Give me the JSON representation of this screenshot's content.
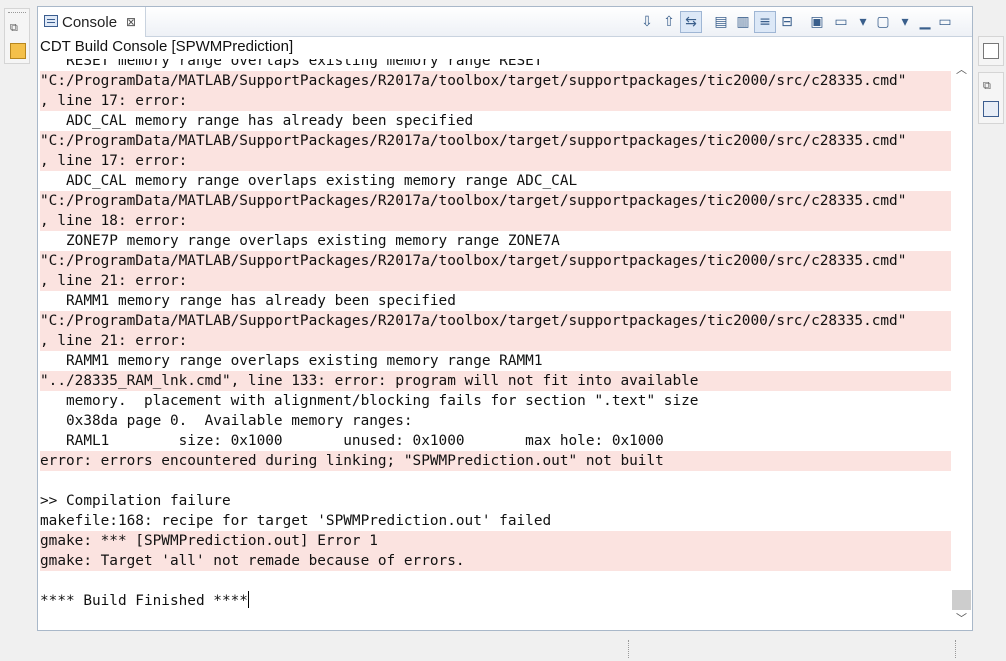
{
  "tab": {
    "title": "Console",
    "close_glyph": "⊠"
  },
  "console_title": "CDT Build Console [SPWMPrediction]",
  "toolbar": [
    {
      "name": "scroll-down-icon",
      "glyph": "⇩"
    },
    {
      "name": "scroll-up-icon",
      "glyph": "⇧"
    },
    {
      "name": "link-icon",
      "glyph": "⇆"
    },
    {
      "name": "copy-icon",
      "glyph": "▤"
    },
    {
      "name": "paste-icon",
      "glyph": "▥"
    },
    {
      "name": "word-wrap-icon",
      "glyph": "≡"
    },
    {
      "name": "clear-console-icon",
      "glyph": "⊟"
    },
    {
      "name": "pin-console-icon",
      "glyph": "▣"
    },
    {
      "name": "display-console-icon",
      "glyph": "▭"
    },
    {
      "name": "dropdown-icon",
      "glyph": "▾"
    },
    {
      "name": "open-console-icon",
      "glyph": "▢"
    },
    {
      "name": "dropdown-icon",
      "glyph": "▾"
    },
    {
      "name": "minimize-icon",
      "glyph": "▁"
    },
    {
      "name": "maximize-icon",
      "glyph": "▭"
    }
  ],
  "lines": [
    {
      "text": "   RESET memory range overlaps existing memory range RESET",
      "err": false
    },
    {
      "text": "\"C:/ProgramData/MATLAB/SupportPackages/R2017a/toolbox/target/supportpackages/tic2000/src/c28335.cmd\"",
      "err": true
    },
    {
      "text": ", line 17: error:",
      "err": true
    },
    {
      "text": "   ADC_CAL memory range has already been specified",
      "err": false
    },
    {
      "text": "\"C:/ProgramData/MATLAB/SupportPackages/R2017a/toolbox/target/supportpackages/tic2000/src/c28335.cmd\"",
      "err": true
    },
    {
      "text": ", line 17: error:",
      "err": true
    },
    {
      "text": "   ADC_CAL memory range overlaps existing memory range ADC_CAL",
      "err": false
    },
    {
      "text": "\"C:/ProgramData/MATLAB/SupportPackages/R2017a/toolbox/target/supportpackages/tic2000/src/c28335.cmd\"",
      "err": true
    },
    {
      "text": ", line 18: error:",
      "err": true
    },
    {
      "text": "   ZONE7P memory range overlaps existing memory range ZONE7A",
      "err": false
    },
    {
      "text": "\"C:/ProgramData/MATLAB/SupportPackages/R2017a/toolbox/target/supportpackages/tic2000/src/c28335.cmd\"",
      "err": true
    },
    {
      "text": ", line 21: error:",
      "err": true
    },
    {
      "text": "   RAMM1 memory range has already been specified",
      "err": false
    },
    {
      "text": "\"C:/ProgramData/MATLAB/SupportPackages/R2017a/toolbox/target/supportpackages/tic2000/src/c28335.cmd\"",
      "err": true
    },
    {
      "text": ", line 21: error:",
      "err": true
    },
    {
      "text": "   RAMM1 memory range overlaps existing memory range RAMM1",
      "err": false
    },
    {
      "text": "\"../28335_RAM_lnk.cmd\", line 133: error: program will not fit into available",
      "err": true
    },
    {
      "text": "   memory.  placement with alignment/blocking fails for section \".text\" size",
      "err": false
    },
    {
      "text": "   0x38da page 0.  Available memory ranges:",
      "err": false
    },
    {
      "text": "   RAML1        size: 0x1000       unused: 0x1000       max hole: 0x1000",
      "err": false
    },
    {
      "text": "error: errors encountered during linking; \"SPWMPrediction.out\" not built",
      "err": true
    },
    {
      "text": "",
      "err": false
    },
    {
      "text": ">> Compilation failure",
      "err": false
    },
    {
      "text": "makefile:168: recipe for target 'SPWMPrediction.out' failed",
      "err": false
    },
    {
      "text": "gmake: *** [SPWMPrediction.out] Error 1",
      "err": true
    },
    {
      "text": "gmake: Target 'all' not remade because of errors.",
      "err": true
    },
    {
      "text": "",
      "err": false
    },
    {
      "text": "**** Build Finished ****",
      "err": false,
      "cursor": true
    }
  ],
  "colors": {
    "error_bg": "#fbe3e0",
    "text": "#111111",
    "view_border": "#a9b8c9"
  }
}
